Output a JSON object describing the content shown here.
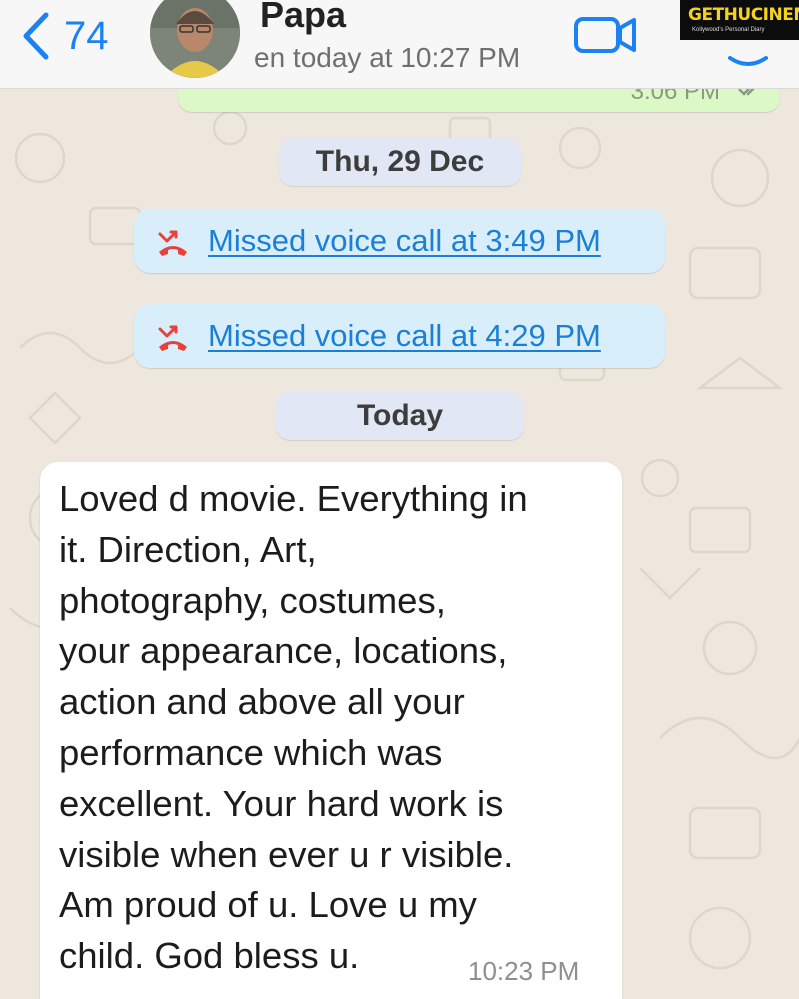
{
  "header": {
    "back_count": "74",
    "contact_name": "Papa",
    "last_seen": "en today at 10:27 PM",
    "watermark_title": "GETHUCINEMA",
    "watermark_sub": "Kollywood's Personal Diary"
  },
  "messages": {
    "sent_partial_time": "3:06 PM",
    "date1": "Thu, 29 Dec",
    "missed1": "Missed voice call at 3:49 PM",
    "missed2": "Missed voice call at 4:29 PM",
    "date2": "Today",
    "received_lines": [
      "Loved d movie. Everything in",
      "it. Direction, Art,",
      "photography, costumes,",
      "your appearance, locations,",
      "action and above all your",
      "performance which was",
      "excellent. Your hard work is",
      "visible when ever u r visible.",
      "Am proud of u. Love u my",
      "child. God bless u."
    ],
    "received_time": "10:23 PM"
  },
  "colors": {
    "accent": "#1a82f5",
    "missed_call_red": "#e8403a",
    "sent_bubble": "#dcf8c6",
    "received_bubble": "#ffffff",
    "date_pill": "#e2e7f6",
    "missed_bubble": "#d9eefb"
  },
  "icons": {
    "back": "chevron-left-icon",
    "video": "video-camera-icon",
    "call": "phone-icon",
    "missed": "missed-call-icon",
    "read_ticks": "double-check-icon"
  }
}
